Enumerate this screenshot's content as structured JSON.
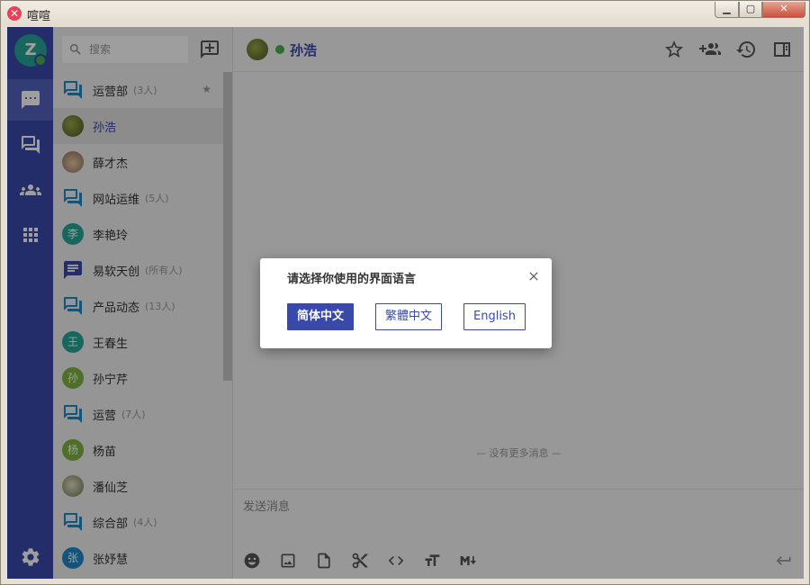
{
  "window": {
    "title": "喧喧",
    "controls": [
      "▁",
      "▢",
      "✕"
    ]
  },
  "nav": {
    "user_initial": "Z",
    "items": [
      {
        "icon": "chat-bubble-icon",
        "active": true
      },
      {
        "icon": "chats-icon",
        "active": false
      },
      {
        "icon": "contacts-icon",
        "active": false
      },
      {
        "icon": "apps-grid-icon",
        "active": false
      },
      {
        "icon": "settings-icon",
        "active": false
      }
    ]
  },
  "search": {
    "placeholder": "搜索"
  },
  "chats": [
    {
      "name": "运营部",
      "count": "(3人)",
      "type": "group",
      "starred": true
    },
    {
      "name": "孙浩",
      "type": "user",
      "avatar": "photo",
      "active": true
    },
    {
      "name": "薛才杰",
      "type": "user",
      "avatar": "photo"
    },
    {
      "name": "网站运维",
      "count": "(5人)",
      "type": "group"
    },
    {
      "name": "李艳玲",
      "type": "user",
      "initial": "李",
      "color": "#26a69a"
    },
    {
      "name": "易软天创",
      "count": "(所有人)",
      "type": "system"
    },
    {
      "name": "产品动态",
      "count": "(13人)",
      "type": "group"
    },
    {
      "name": "王春生",
      "type": "user",
      "initial": "王",
      "color": "#26a69a"
    },
    {
      "name": "孙宁芹",
      "type": "user",
      "initial": "孙",
      "color": "#7cb342"
    },
    {
      "name": "运营",
      "count": "(7人)",
      "type": "group"
    },
    {
      "name": "杨苗",
      "type": "user",
      "initial": "杨",
      "color": "#7cb342"
    },
    {
      "name": "潘仙芝",
      "type": "user",
      "avatar": "photo"
    },
    {
      "name": "综合部",
      "count": "(4人)",
      "type": "group"
    },
    {
      "name": "张妤慧",
      "type": "user",
      "initial": "张",
      "color": "#1e88c9"
    }
  ],
  "chat": {
    "name": "孙浩",
    "no_more_messages": "— 没有更多消息 —",
    "composer_placeholder": "发送消息"
  },
  "dialog": {
    "title": "请选择你使用的界面语言",
    "options": [
      "简体中文",
      "繁體中文",
      "English"
    ]
  },
  "colors": {
    "primary": "#3949ab",
    "online": "#4caf50",
    "group_icon": "#1e88c9"
  }
}
